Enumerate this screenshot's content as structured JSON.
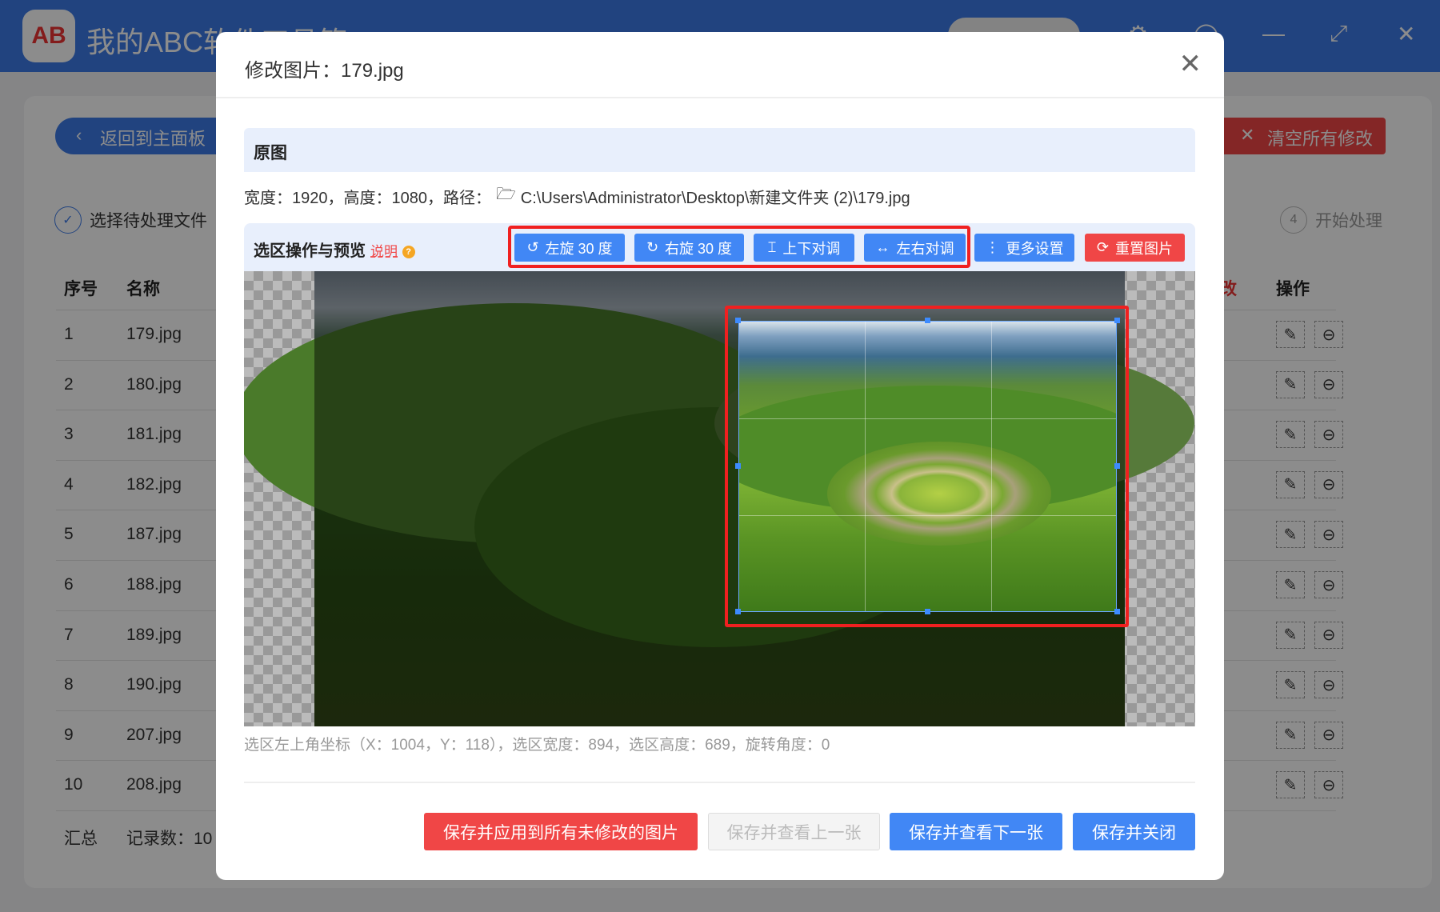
{
  "app": {
    "title": "我的ABC软件工具箱",
    "logo_text": "AB"
  },
  "background": {
    "back_button": "返回到主面板",
    "clear_button": "清空所有修改",
    "step1": "选择待处理文件",
    "step4_num": "4",
    "step4": "开始处理",
    "table": {
      "headers": {
        "index": "序号",
        "name": "名称",
        "modified": "改",
        "actions": "操作"
      },
      "rows": [
        {
          "index": "1",
          "name": "179.jpg"
        },
        {
          "index": "2",
          "name": "180.jpg"
        },
        {
          "index": "3",
          "name": "181.jpg"
        },
        {
          "index": "4",
          "name": "182.jpg"
        },
        {
          "index": "5",
          "name": "187.jpg"
        },
        {
          "index": "6",
          "name": "188.jpg"
        },
        {
          "index": "7",
          "name": "189.jpg"
        },
        {
          "index": "8",
          "name": "190.jpg"
        },
        {
          "index": "9",
          "name": "207.jpg"
        },
        {
          "index": "10",
          "name": "208.jpg"
        }
      ],
      "summary_label": "汇总",
      "summary_count": "记录数：10"
    }
  },
  "modal": {
    "title": "修改图片：179.jpg",
    "section_original": "原图",
    "info_text": "宽度：1920，高度：1080，路径：",
    "path": "C:\\Users\\Administrator\\Desktop\\新建文件夹 (2)\\179.jpg",
    "toolbar_label": "选区操作与预览",
    "help_link": "说明",
    "buttons": {
      "rotate_left": "左旋 30 度",
      "rotate_right": "右旋 30 度",
      "flip_vertical": "上下对调",
      "flip_horizontal": "左右对调",
      "more_settings": "更多设置",
      "reset": "重置图片"
    },
    "status": "选区左上角坐标（X：1004，Y：118），选区宽度：894，选区高度：689，旋转角度：0",
    "footer": {
      "apply_all": "保存并应用到所有未修改的图片",
      "prev": "保存并查看上一张",
      "next": "保存并查看下一张",
      "close": "保存并关闭"
    }
  },
  "colors": {
    "primary": "#4187f5",
    "danger": "#f04646",
    "highlight": "#f02020"
  }
}
